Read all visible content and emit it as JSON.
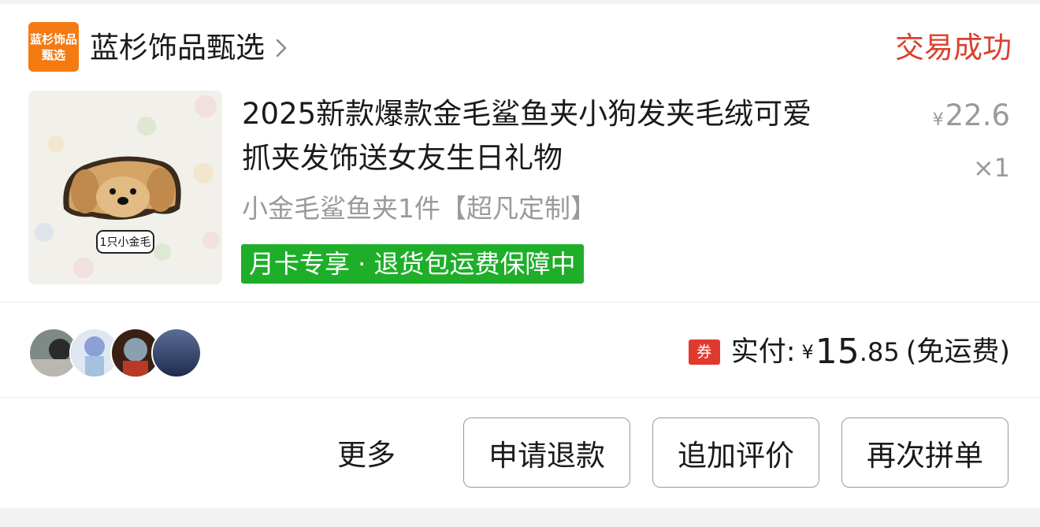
{
  "shop": {
    "logo_line1": "蓝杉饰品",
    "logo_line2": "甄选",
    "name": "蓝杉饰品甄选",
    "status": "交易成功"
  },
  "product": {
    "image_caption": "1只小金毛",
    "title_line1": "2025新款爆款金毛鲨鱼夹小狗发夹毛绒可爱",
    "title_line2": "抓夹发饰送女友生日礼物",
    "price_currency": "¥",
    "price": "22.6",
    "quantity": "×1",
    "sku": "小金毛鲨鱼夹1件【超凡定制】",
    "guarantee": "月卡专享 · 退货包运费保障中"
  },
  "payment": {
    "coupon_label": "券",
    "label": "实付:",
    "currency": "¥",
    "amount_int": "15",
    "amount_dec": ".85",
    "note": "(免运费)"
  },
  "actions": {
    "more": "更多",
    "refund": "申请退款",
    "add_review": "追加评价",
    "regroup": "再次拼单"
  },
  "colors": {
    "status": "#d9412f",
    "logo_bg": "#f47a12",
    "guarantee_bg": "#1fae2a",
    "coupon_bg": "#e03a2e"
  },
  "icons": [
    "chevron-right-icon",
    "coupon-icon"
  ]
}
